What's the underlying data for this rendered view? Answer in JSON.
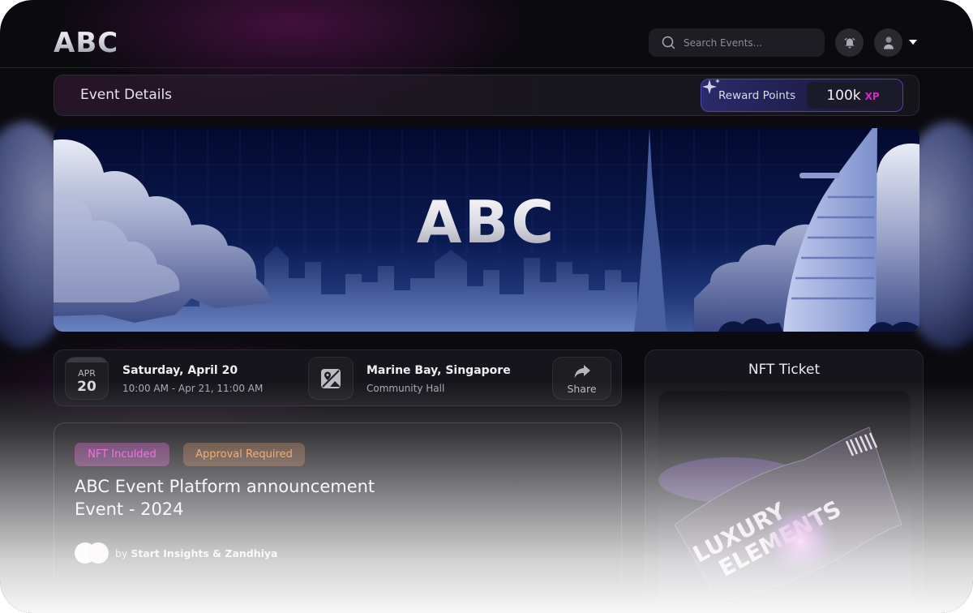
{
  "header": {
    "logo": "ABC",
    "search": {
      "placeholder": "Search Events...",
      "value": ""
    }
  },
  "details_bar": {
    "title": "Event Details",
    "reward": {
      "label": "Reward Points",
      "value": "100k",
      "unit": "XP"
    }
  },
  "banner": {
    "logo": "ABC"
  },
  "info": {
    "date": {
      "month": "APR",
      "day": "20",
      "title": "Saturday, April 20",
      "time": "10:00 AM - Apr 21, 11:00 AM"
    },
    "location": {
      "title": "Marine Bay, Singapore",
      "venue": "Community Hall"
    },
    "share_label": "Share"
  },
  "event": {
    "badges": [
      {
        "label": "NFT Inculded",
        "color": "#e23fd8"
      },
      {
        "label": "Approval Required",
        "color": "#f08c3a"
      }
    ],
    "title": "ABC Event Platform announcement Event - 2024",
    "hosts_prefix": "by",
    "hosts": "Start Insights & Zandhiya"
  },
  "nft": {
    "title": "NFT Ticket",
    "ticket_text": [
      "LUXURY",
      "ELEMENTS"
    ]
  },
  "colors": {
    "accent_xp": "#d12bc6",
    "reward_border": "#4d45b0",
    "background": "#0b0a0f"
  }
}
